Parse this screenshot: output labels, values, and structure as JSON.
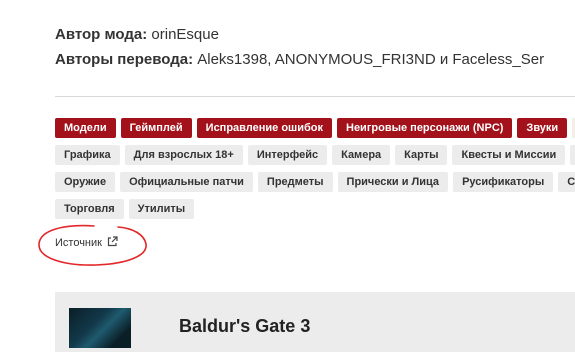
{
  "info": {
    "mod_author_label": "Автор мода:",
    "mod_author": "orinEsque",
    "translators_label": "Авторы перевода:",
    "translators": "Aleks1398, ANONYMOUS_FRI3ND и Faceless_Ser"
  },
  "tags": {
    "row1": [
      "Модели",
      "Геймплей",
      "Исправление ошибок",
      "Неигровые персонажи (NPC)",
      "Звуки"
    ],
    "row2": [
      "Графика",
      "Для взрослых 18+",
      "Интерфейс",
      "Камера",
      "Карты",
      "Квесты и Миссии"
    ],
    "row3": [
      "Оружие",
      "Официальные патчи",
      "Предметы",
      "Прически и Лица",
      "Русификаторы",
      "Сау"
    ],
    "row4": [
      "Торговля",
      "Утилиты"
    ]
  },
  "source": {
    "label": "Источник",
    "icon": "external-link-icon"
  },
  "annotation_color": "#e3262a",
  "card": {
    "title": "Baldur's Gate 3"
  },
  "colors": {
    "tag_red": "#a3121a",
    "tag_gray": "#ececec"
  }
}
